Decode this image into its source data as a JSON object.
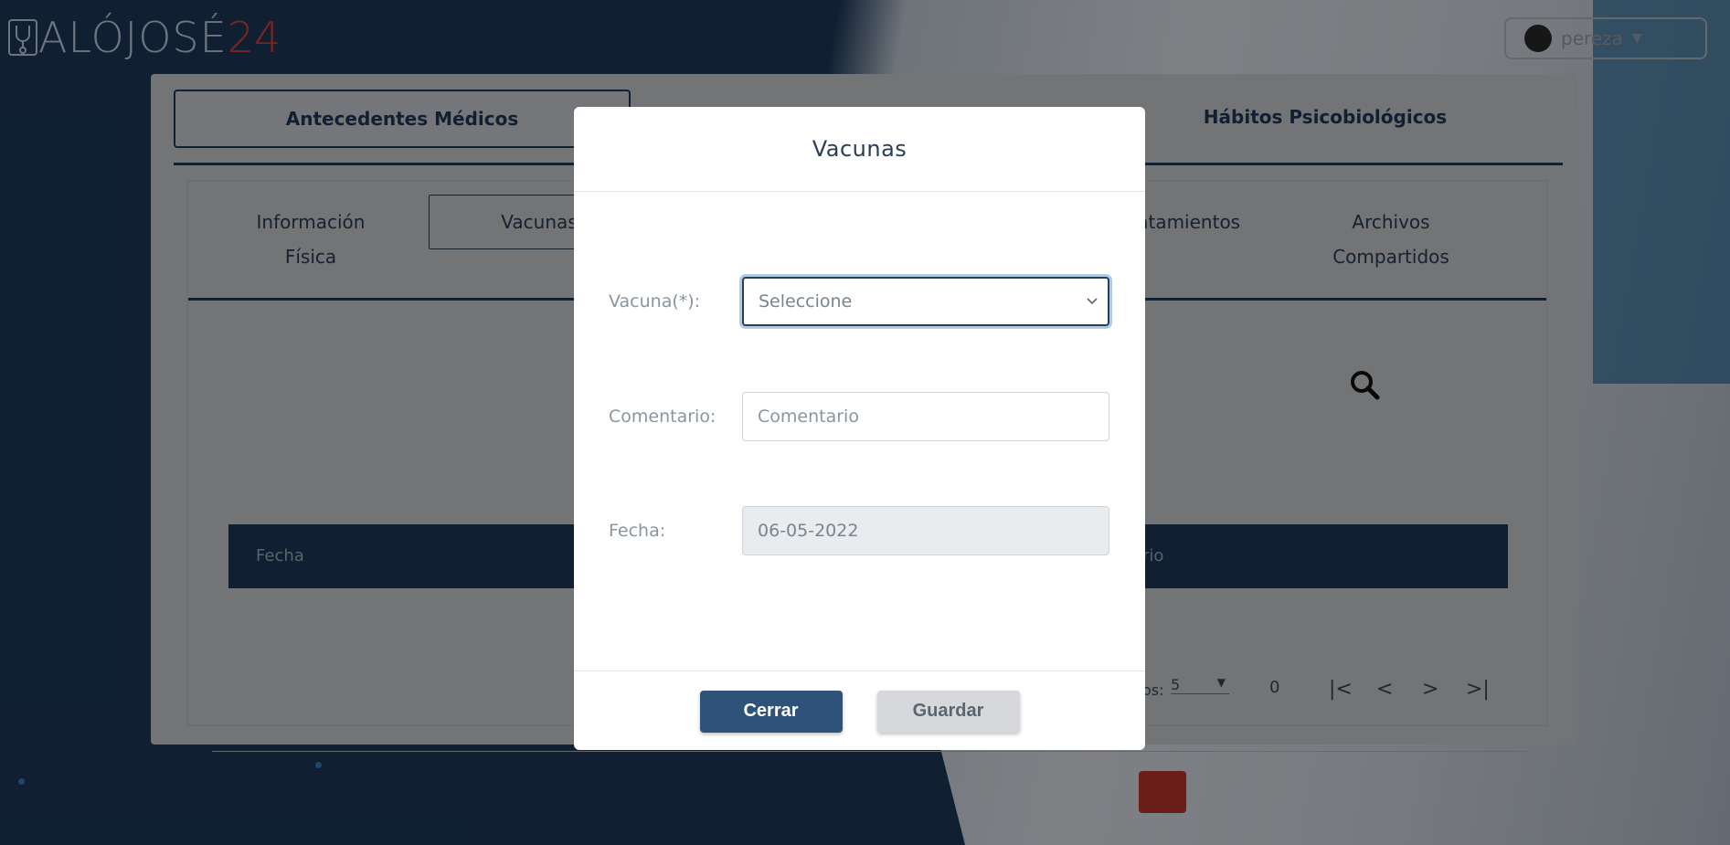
{
  "app": {
    "logo_name": "ALÓJOSÉ",
    "logo_number": "24"
  },
  "user": {
    "name": "pereza"
  },
  "main_tabs": [
    {
      "label": "Antecedentes Médicos",
      "active": true
    },
    {
      "label": "Hábitos Psicobiológicos",
      "active": false
    }
  ],
  "sub_tabs": [
    {
      "label": "Información Física"
    },
    {
      "label": "Vacunas"
    },
    {
      "label": "ratamientos"
    },
    {
      "label": "Archivos Compartidos"
    }
  ],
  "table": {
    "col_fecha": "Fecha",
    "col_partial": "rio"
  },
  "pager": {
    "rows_label": "os:",
    "rows_value": "5",
    "count": "0"
  },
  "modal": {
    "title": "Vacunas",
    "vacuna_label": "Vacuna(*):",
    "vacuna_value": "Seleccione",
    "comentario_label": "Comentario:",
    "comentario_placeholder": "Comentario",
    "fecha_label": "Fecha:",
    "fecha_value": "06-05-2022",
    "close_label": "Cerrar",
    "save_label": "Guardar"
  },
  "icons": {
    "search": "search-icon",
    "caret": "caret-down-icon",
    "chevron": "chevron-down-icon",
    "pager_first": "first-page-icon",
    "pager_prev": "prev-page-icon",
    "pager_next": "next-page-icon",
    "pager_last": "last-page-icon"
  },
  "colors": {
    "primary": "#2e5279",
    "navy": "#1e3a5c",
    "danger": "#c0392b",
    "logo_accent": "#d9463c"
  }
}
